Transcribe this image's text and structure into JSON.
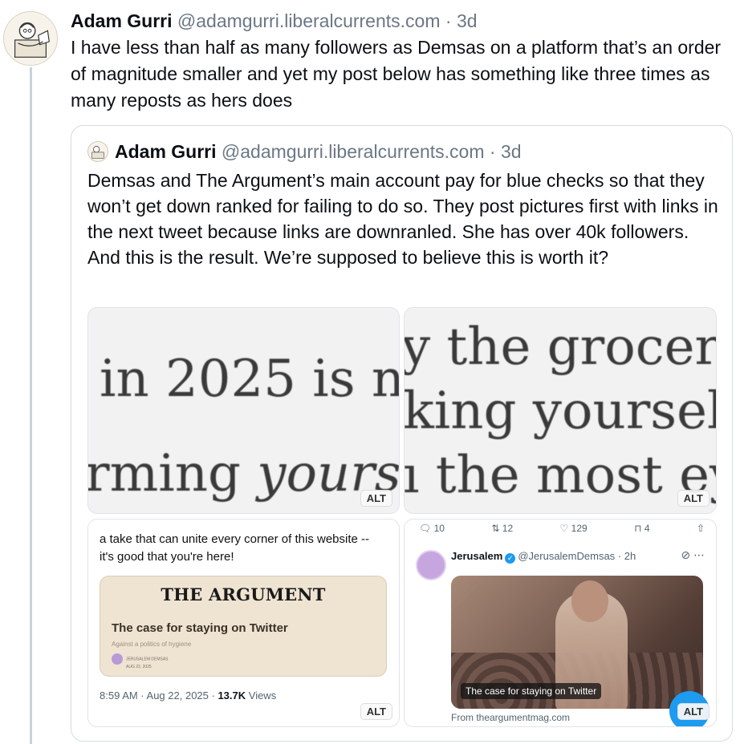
{
  "post": {
    "author_name": "Adam Gurri",
    "handle": "@adamgurri.liberalcurrents.com",
    "separator": "·",
    "age": "3d",
    "text": "I have less than half as many followers as Demsas on a platform that’s an order of magnitude smaller and yet my post below has something like three times as many reposts as hers does"
  },
  "quote": {
    "author_name": "Adam Gurri",
    "handle": "@adamgurri.liberalcurrents.com",
    "separator": "·",
    "age": "3d",
    "text": "Demsas and The Argument’s main account pay for blue checks so that they won’t get down ranked for failing to do so. They post pictures first with links in the next tweet because links are downranled. She has over 40k followers. And this is the result. We’re supposed to believe this is worth it?"
  },
  "images": {
    "alt_label": "ALT",
    "tile1": {
      "line1": "in 2025 is n",
      "line2a": "rming ",
      "line2b": "yours"
    },
    "tile2": {
      "line1": "y the grocery-br",
      "line2": "king yourself ou",
      "line3": "ı the most eyeba"
    },
    "tile3": {
      "tweet_text": "a take that can unite every corner of this website -- it's good that you're here!",
      "card_title": "THE ARGUMENT",
      "card_headline": "The case for staying on Twitter",
      "card_sub": "Against a politics of hygiene",
      "card_author": "JERUSALEM DEMSAS",
      "card_date": "AUG 22, 2025",
      "time": "8:59 AM · Aug 22, 2025 · ",
      "views_count": "13.7K",
      "views_label": " Views"
    },
    "tile4": {
      "replies": "10",
      "reposts": "12",
      "likes": "129",
      "bookmarks": "4",
      "name": "Jerusalem",
      "handle": "@JerusalemDemsas · 2h",
      "photo_caption": "The case for staying on Twitter",
      "from": "From theargumentmag.com"
    }
  },
  "colors": {
    "accent": "#1d9bf0",
    "muted": "#6b7785",
    "border": "#d4dbe2"
  }
}
